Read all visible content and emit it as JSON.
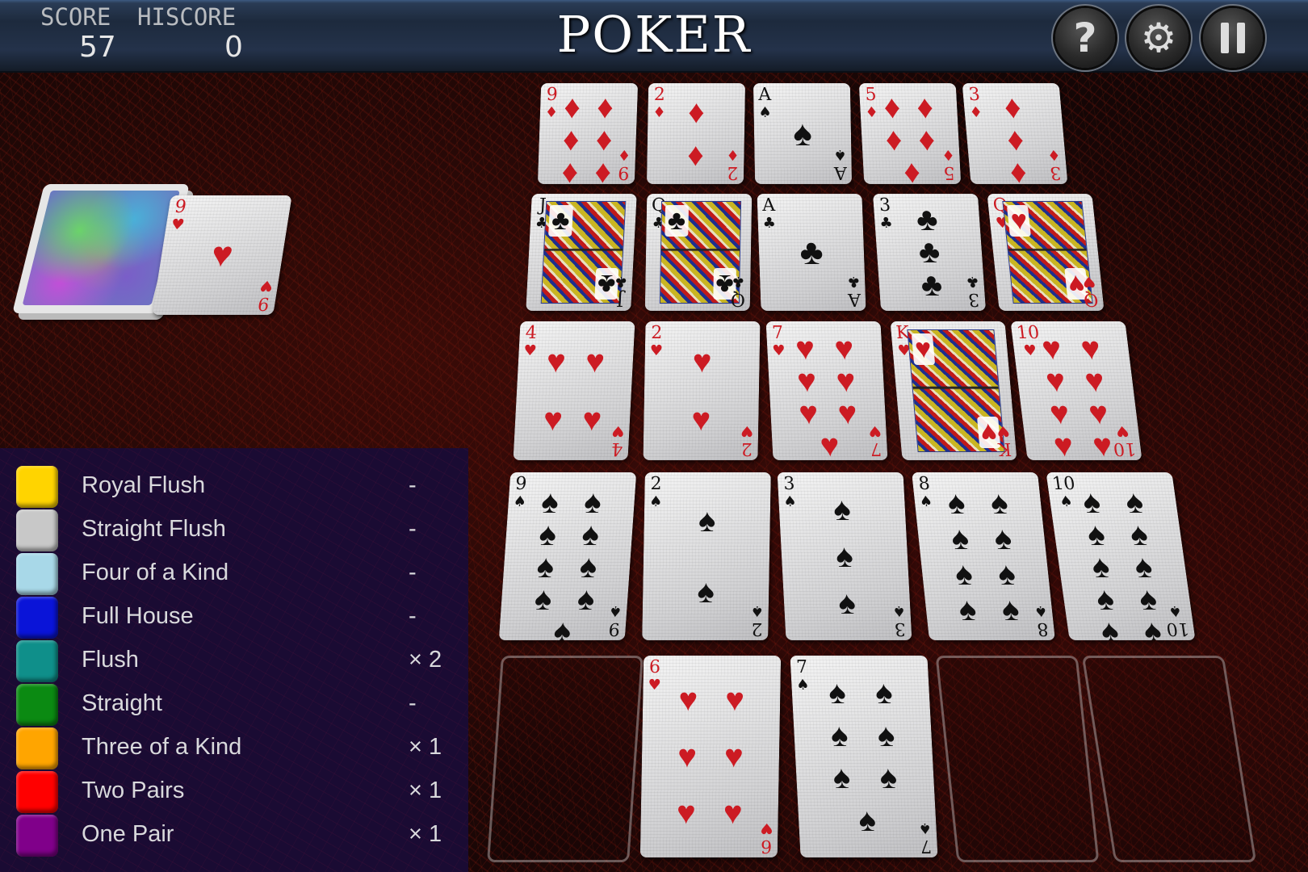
{
  "header": {
    "score_label": "SCORE",
    "score_value": "57",
    "hiscore_label": "HISCORE",
    "hiscore_value": "0",
    "title": "POKER",
    "buttons": {
      "help": {
        "icon": "question-mark-icon",
        "glyph": "?"
      },
      "settings": {
        "icon": "gear-icon",
        "glyph": "⚙"
      },
      "pause": {
        "icon": "pause-icon"
      }
    }
  },
  "deck": {
    "draw_pile": {
      "face": "down"
    },
    "current_card": {
      "rank": "9",
      "suit": "♥",
      "color": "red"
    }
  },
  "legend": {
    "rows": [
      {
        "name": "Royal Flush",
        "count": "-",
        "color": "#ffd400"
      },
      {
        "name": "Straight Flush",
        "count": "-",
        "color": "#c8c8c8"
      },
      {
        "name": "Four of a Kind",
        "count": "-",
        "color": "#a8d8e8"
      },
      {
        "name": "Full House",
        "count": "-",
        "color": "#0a14d8"
      },
      {
        "name": "Flush",
        "count": "× 2",
        "color": "#0f8f8a"
      },
      {
        "name": "Straight",
        "count": "-",
        "color": "#0b8a12"
      },
      {
        "name": "Three of a Kind",
        "count": "× 1",
        "color": "#ffa500"
      },
      {
        "name": "Two Pairs",
        "count": "× 1",
        "color": "#ff0000"
      },
      {
        "name": "One Pair",
        "count": "× 1",
        "color": "#80008a"
      }
    ]
  },
  "grid": {
    "rows": [
      [
        {
          "rank": "9",
          "suit": "♦",
          "color": "red",
          "pips": 9
        },
        {
          "rank": "2",
          "suit": "♦",
          "color": "red",
          "pips": 2
        },
        {
          "rank": "A",
          "suit": "♠",
          "color": "blk",
          "pips": 1
        },
        {
          "rank": "5",
          "suit": "♦",
          "color": "red",
          "pips": 5
        },
        {
          "rank": "3",
          "suit": "♦",
          "color": "red",
          "pips": 3
        }
      ],
      [
        {
          "rank": "J",
          "suit": "♣",
          "color": "blk",
          "face": true
        },
        {
          "rank": "Q",
          "suit": "♣",
          "color": "blk",
          "face": true
        },
        {
          "rank": "A",
          "suit": "♣",
          "color": "blk",
          "pips": 1
        },
        {
          "rank": "3",
          "suit": "♣",
          "color": "blk",
          "pips": 3
        },
        {
          "rank": "Q",
          "suit": "♥",
          "color": "red",
          "face": true
        }
      ],
      [
        {
          "rank": "4",
          "suit": "♥",
          "color": "red",
          "pips": 4
        },
        {
          "rank": "2",
          "suit": "♥",
          "color": "red",
          "pips": 2
        },
        {
          "rank": "7",
          "suit": "♥",
          "color": "red",
          "pips": 7
        },
        {
          "rank": "K",
          "suit": "♥",
          "color": "red",
          "face": true
        },
        {
          "rank": "10",
          "suit": "♥",
          "color": "red",
          "pips": 10
        }
      ],
      [
        {
          "rank": "9",
          "suit": "♠",
          "color": "blk",
          "pips": 9
        },
        {
          "rank": "2",
          "suit": "♠",
          "color": "blk",
          "pips": 2
        },
        {
          "rank": "3",
          "suit": "♠",
          "color": "blk",
          "pips": 3
        },
        {
          "rank": "8",
          "suit": "♠",
          "color": "blk",
          "pips": 8
        },
        {
          "rank": "10",
          "suit": "♠",
          "color": "blk",
          "pips": 10
        }
      ],
      [
        null,
        {
          "rank": "6",
          "suit": "♥",
          "color": "red",
          "pips": 6
        },
        {
          "rank": "7",
          "suit": "♠",
          "color": "blk",
          "pips": 7
        },
        null,
        null
      ]
    ]
  }
}
